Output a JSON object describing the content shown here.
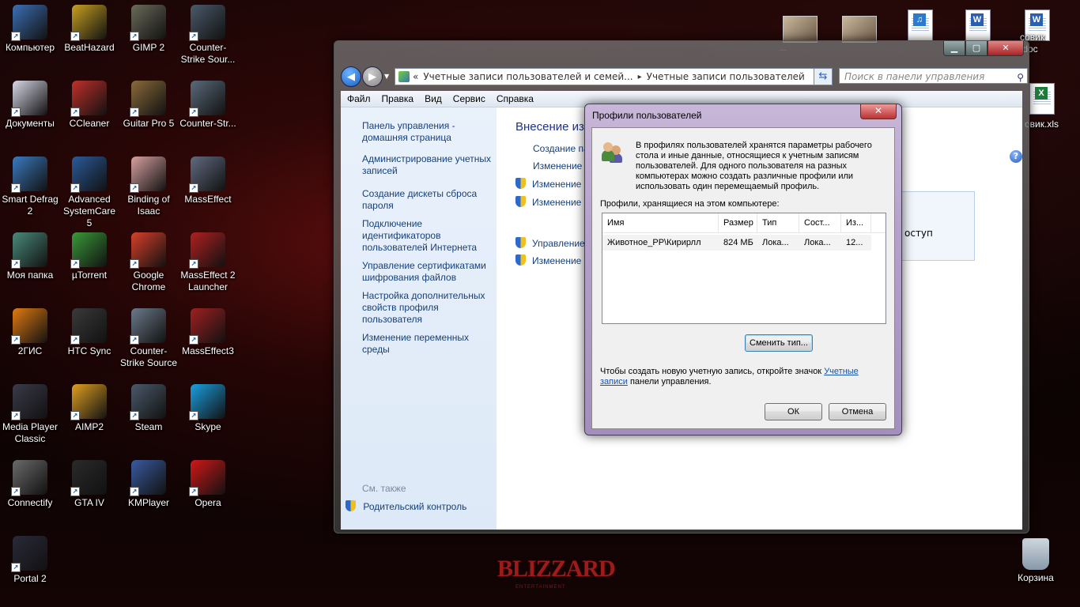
{
  "desktop": {
    "icons": [
      {
        "label": "Компьютер",
        "color": "#3b6fb5"
      },
      {
        "label": "BeatHazard",
        "color": "#c8a020"
      },
      {
        "label": "GIMP 2",
        "color": "#6b6b5a"
      },
      {
        "label": "Counter-\nStrike Sour...",
        "color": "#4a5a6a"
      },
      {
        "label": "Документы",
        "color": "#d8d8e8"
      },
      {
        "label": "CCleaner",
        "color": "#c0302a"
      },
      {
        "label": "Guitar Pro 5",
        "color": "#8a6a3a"
      },
      {
        "label": "Counter-Str...",
        "color": "#5a6a7a"
      },
      {
        "label": "Smart Defrag\n2",
        "color": "#3a7ac0"
      },
      {
        "label": "Advanced\nSystemCare 5",
        "color": "#2a5a9a"
      },
      {
        "label": "Binding of\nIsaac",
        "color": "#d8a0a0"
      },
      {
        "label": "MassEffect",
        "color": "#606a80"
      },
      {
        "label": "Моя папка",
        "color": "#4a8a7a"
      },
      {
        "label": "µTorrent",
        "color": "#3a9a3a"
      },
      {
        "label": "Google\nChrome",
        "color": "#d8402a"
      },
      {
        "label": "MassEffect 2\nLauncher",
        "color": "#b02020"
      },
      {
        "label": "2ГИС",
        "color": "#e07a10"
      },
      {
        "label": "HTC Sync",
        "color": "#3a3a3a"
      },
      {
        "label": "Counter-\nStrike Source",
        "color": "#6a7a8a"
      },
      {
        "label": "MassEffect3",
        "color": "#a02020"
      },
      {
        "label": "Media Player\nClassic",
        "color": "#3a3a4a"
      },
      {
        "label": "AIMP2",
        "color": "#e0a020"
      },
      {
        "label": "Steam",
        "color": "#4a5a6a"
      },
      {
        "label": "Skype",
        "color": "#1aa0e0"
      },
      {
        "label": "Connectify",
        "color": "#6a6a6a"
      },
      {
        "label": "GTA IV",
        "color": "#2a2a2a"
      },
      {
        "label": "KMPlayer",
        "color": "#3a5aa0"
      },
      {
        "label": "Opera",
        "color": "#d01818"
      },
      {
        "label": "Portal 2",
        "color": "#2a2a3a"
      }
    ],
    "right_items": {
      "doc1_label": "совик\n.doc",
      "xls_label": "овик.xls",
      "recycle_label": "Корзина"
    },
    "wallpaper_logo": "BLIZZARD",
    "wallpaper_logo_sub": "ENTERTAINMENT"
  },
  "control_panel": {
    "address": {
      "prefix": "«",
      "crumb1": "Учетные записи пользователей и семей...",
      "sep": "▸",
      "crumb2": "Учетные записи пользователей"
    },
    "search_placeholder": "Поиск в панели управления",
    "menu": [
      "Файл",
      "Правка",
      "Вид",
      "Сервис",
      "Справка"
    ],
    "left_links": [
      "Панель управления -\nдомашняя страница",
      "Администрирование учетных\nзаписей",
      "Создание дискеты сброса\nпароля",
      "Подключение\nидентификаторов\nпользователей Интернета",
      "Управление сертификатами\nшифрования файлов",
      "Настройка дополнительных\nсвойств профиля\nпользователя",
      "Изменение переменных\nсреды"
    ],
    "see_also": "См. также",
    "parental_control": "Родительский контроль",
    "main_heading": "Внесение из",
    "main_links": [
      "Создание па",
      "Изменение",
      "Изменение",
      "Изменение",
      "Управление",
      "Изменение"
    ],
    "infobox_text": "оступ"
  },
  "dialog": {
    "title": "Профили пользователей",
    "description": "В профилях пользователей хранятся параметры рабочего стола и иные данные, относящиеся к учетным записям пользователей. Для одного пользователя на разных компьютерах можно создать различные профили или использовать один перемещаемый профиль.",
    "list_label": "Профили, хранящиеся на этом компьютере:",
    "columns": [
      "Имя",
      "Размер",
      "Тип",
      "Сост...",
      "Из..."
    ],
    "rows": [
      {
        "name": "Животное_PP\\Кирирлл",
        "size": "824 МБ",
        "type": "Лока...",
        "status": "Лока...",
        "modified": "12..."
      }
    ],
    "change_type_button": "Сменить тип...",
    "footer_text": "Чтобы создать новую учетную запись, откройте значок ",
    "footer_link": "Учетные записи",
    "footer_tail": " панели управления.",
    "ok_button": "ОК",
    "cancel_button": "Отмена"
  }
}
